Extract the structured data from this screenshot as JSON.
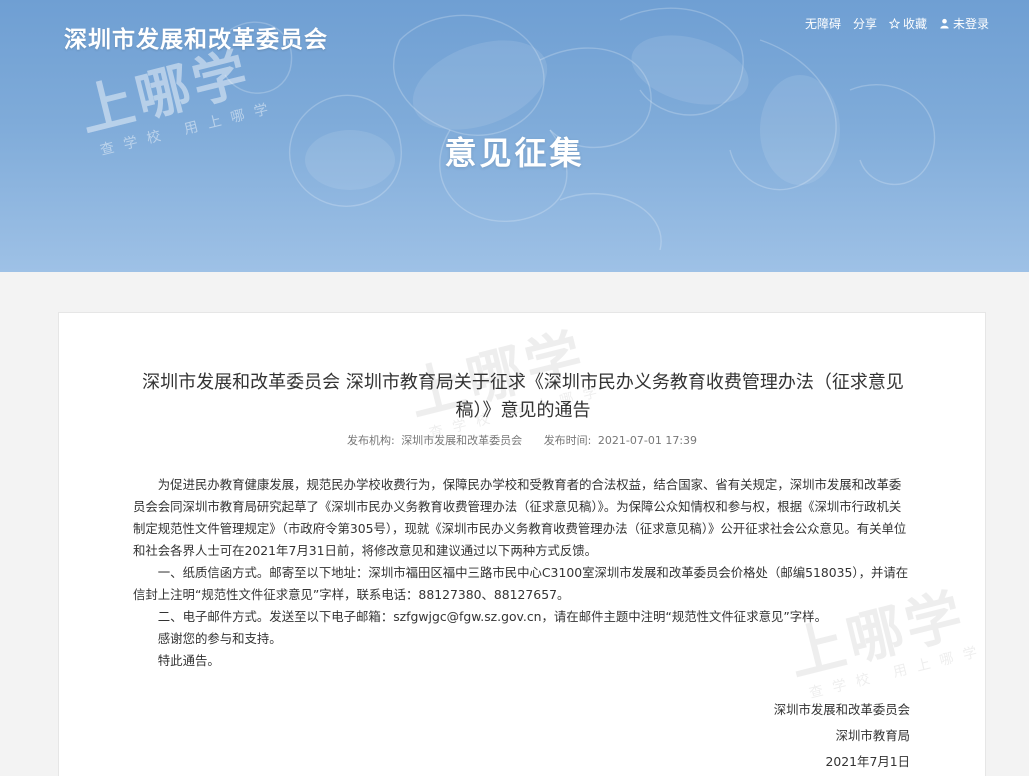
{
  "header": {
    "site_title": "深圳市发展和改革委员会",
    "links": {
      "accessibility": "无障碍",
      "share": "分享",
      "favorite": "收藏",
      "login": "未登录"
    },
    "banner_heading": "意见征集"
  },
  "watermark": {
    "main": "上哪学",
    "sub": "查学校 用上哪学"
  },
  "article": {
    "title": "深圳市发展和改革委员会 深圳市教育局关于征求《深圳市民办义务教育收费管理办法（征求意见稿）》意见的通告",
    "meta": {
      "publisher_label": "发布机构:",
      "publisher": "深圳市发展和改革委员会",
      "time_label": "发布时间:",
      "time": "2021-07-01 17:39"
    },
    "paragraphs": [
      "为促进民办教育健康发展，规范民办学校收费行为，保障民办学校和受教育者的合法权益，结合国家、省有关规定，深圳市发展和改革委员会会同深圳市教育局研究起草了《深圳市民办义务教育收费管理办法（征求意见稿）》。为保障公众知情权和参与权，根据《深圳市行政机关制定规范性文件管理规定》（市政府令第305号），现就《深圳市民办义务教育收费管理办法（征求意见稿）》公开征求社会公众意见。有关单位和社会各界人士可在2021年7月31日前，将修改意见和建议通过以下两种方式反馈。",
      "一、纸质信函方式。邮寄至以下地址：深圳市福田区福中三路市民中心C3100室深圳市发展和改革委员会价格处（邮编518035），并请在信封上注明“规范性文件征求意见”字样，联系电话：88127380、88127657。",
      "二、电子邮件方式。发送至以下电子邮箱：szfgwjgc@fgw.sz.gov.cn，请在邮件主题中注明“规范性文件征求意见”字样。",
      "感谢您的参与和支持。",
      "特此通告。"
    ],
    "signature": {
      "org1": "深圳市发展和改革委员会",
      "org2": "深圳市教育局",
      "date": "2021年7月1日"
    }
  }
}
